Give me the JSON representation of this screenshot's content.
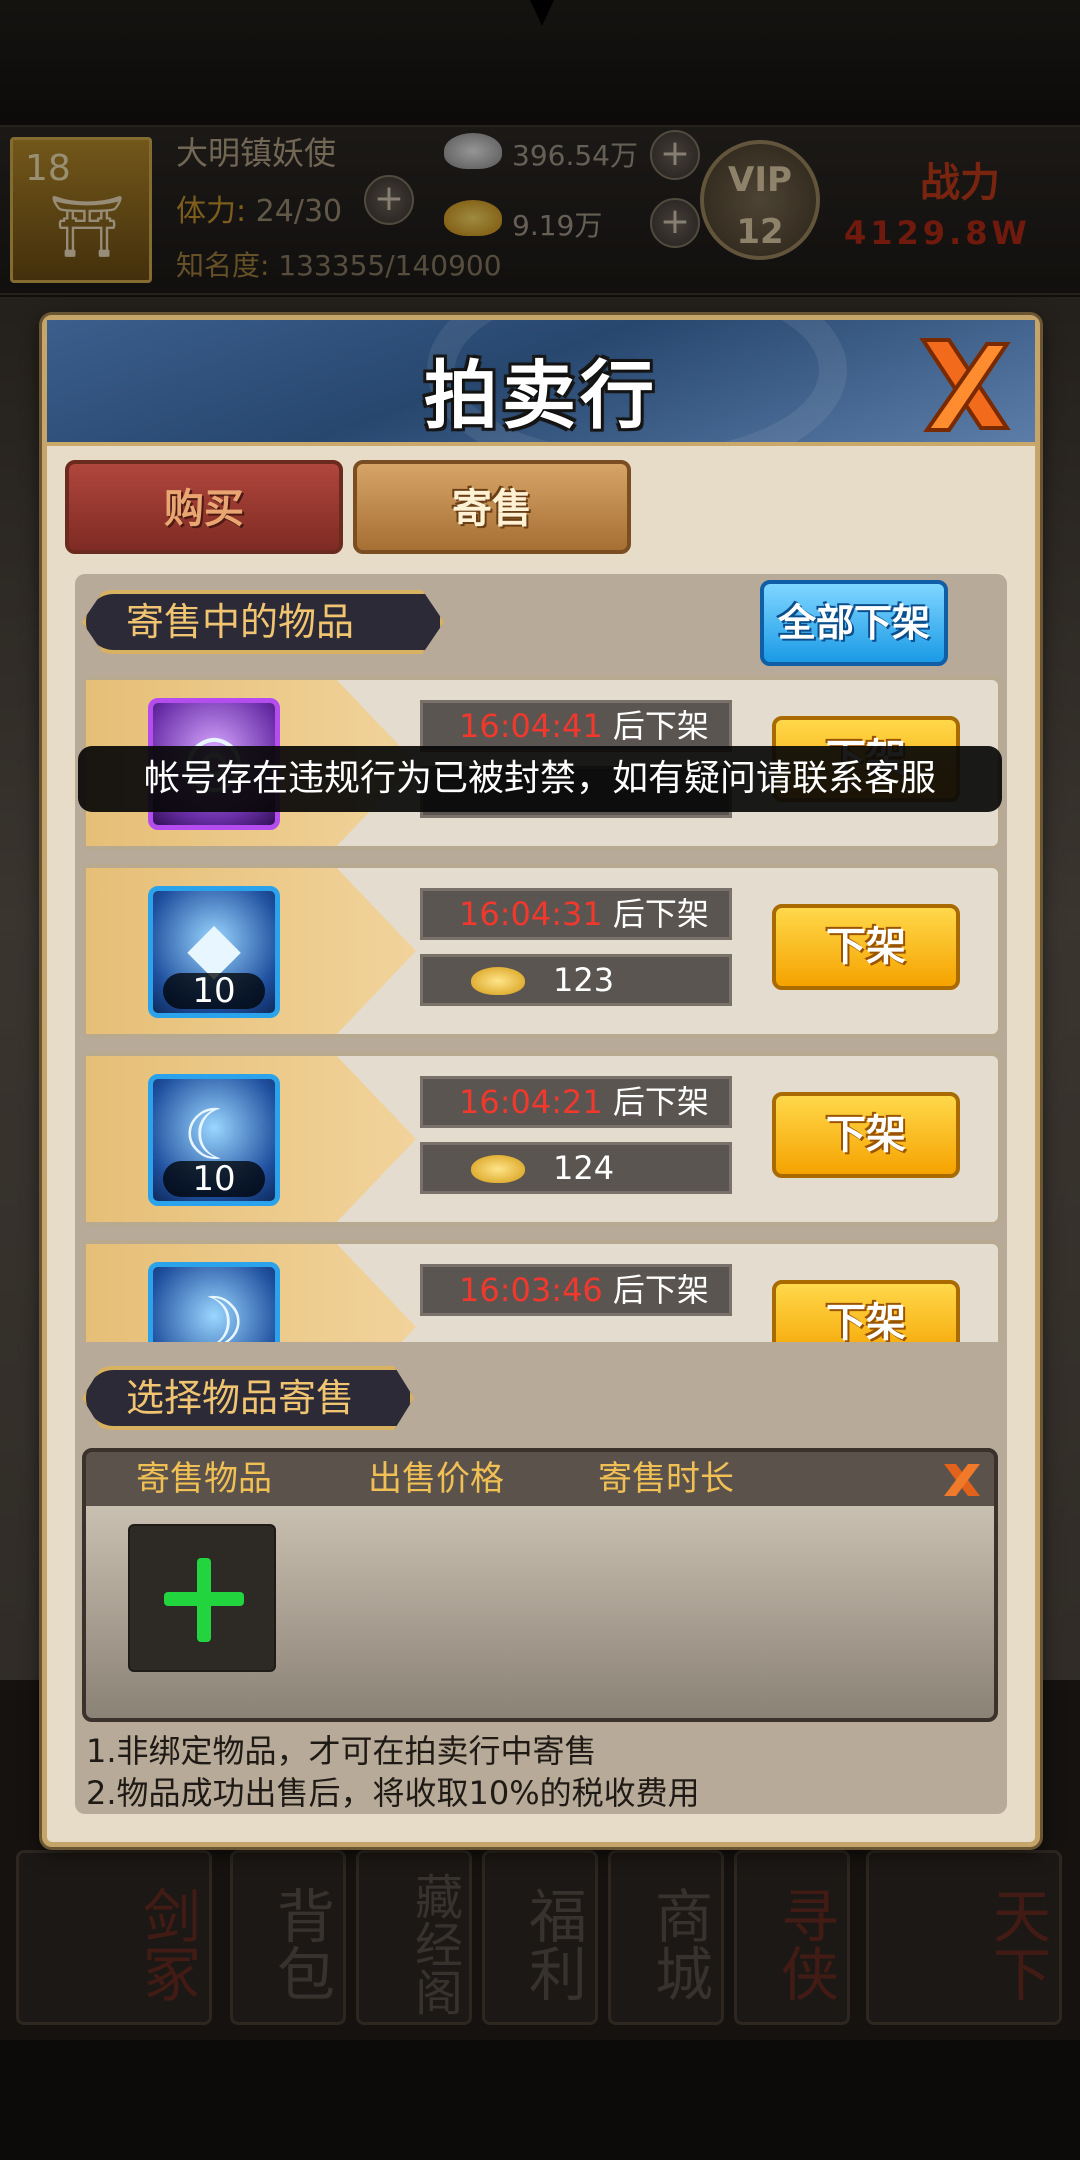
{
  "hud": {
    "level": "18",
    "player_name": "大明镇妖使",
    "stamina_label": "体力:",
    "stamina_value": "24/30",
    "fame_label": "知名度:",
    "fame_value": "133355/140900",
    "silver": "396.54万",
    "gold": "9.19万",
    "vip_label": "VIP",
    "vip_level": "12",
    "power_label": "战力",
    "power_value": "4129.8W"
  },
  "dialog": {
    "title": "拍卖行",
    "tabs": {
      "buy": "购买",
      "sell": "寄售"
    },
    "consigned_label": "寄售中的物品",
    "all_off_button": "全部下架",
    "items": [
      {
        "time": "16:04:41",
        "suffix": "后下架",
        "price": "",
        "count": "",
        "button": "下架"
      },
      {
        "time": "16:04:31",
        "suffix": "后下架",
        "price": "123",
        "count": "10",
        "button": "下架"
      },
      {
        "time": "16:04:21",
        "suffix": "后下架",
        "price": "124",
        "count": "10",
        "button": "下架"
      },
      {
        "time": "16:03:46",
        "suffix": "后下架",
        "price": "",
        "count": "",
        "button": "下架"
      }
    ],
    "select_label": "选择物品寄售",
    "select_headers": {
      "item": "寄售物品",
      "price": "出售价格",
      "duration": "寄售时长"
    },
    "notes": [
      "1.非绑定物品，才可在拍卖行中寄售",
      "2.物品成功出售后，将收取10%的税收费用"
    ]
  },
  "toast": "帐号存在违规行为已被封禁，如有疑问请联系客服",
  "bottom_menu": [
    "剑冢",
    "背包",
    "藏经阁",
    "福利",
    "商城",
    "寻侠",
    "天下"
  ]
}
